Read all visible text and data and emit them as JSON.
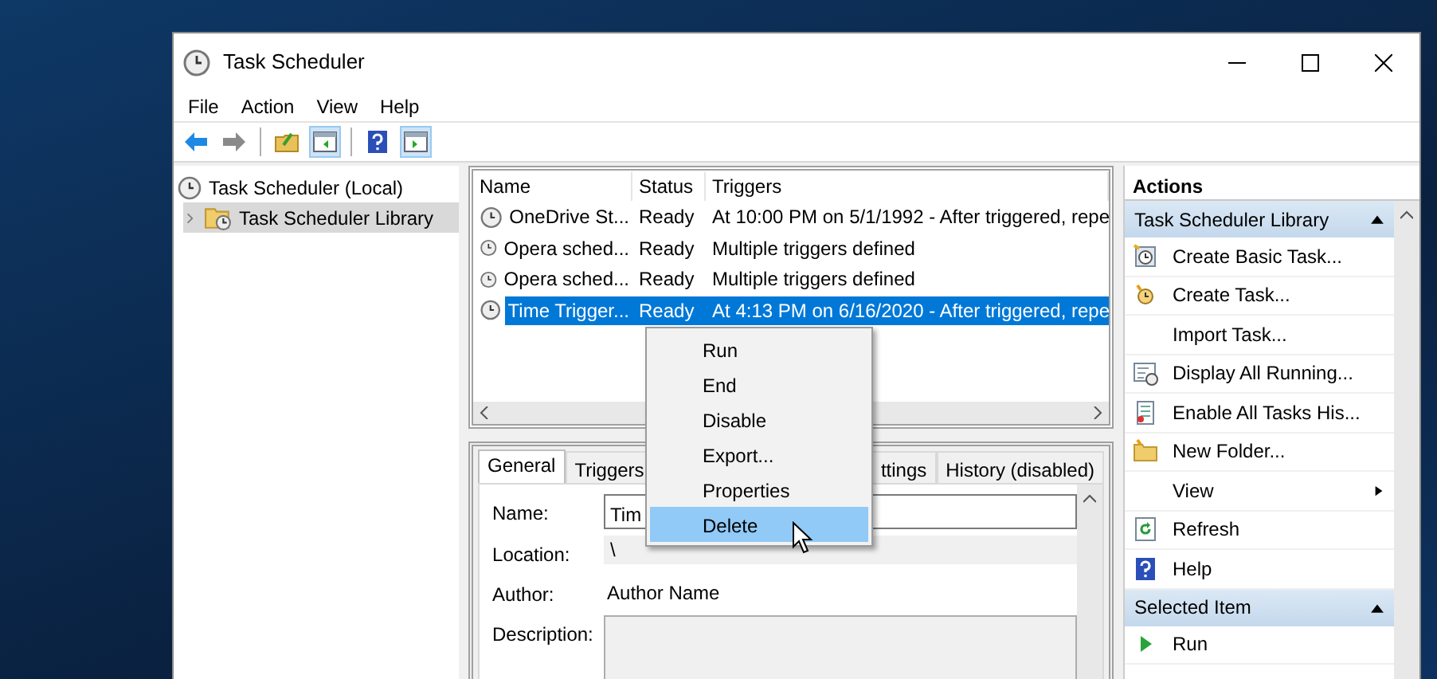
{
  "window": {
    "title": "Task Scheduler"
  },
  "menu": [
    "File",
    "Action",
    "View",
    "Help"
  ],
  "toolbar": [
    {
      "pressed": false
    },
    {
      "pressed": false
    },
    {
      "pressed": false
    },
    {
      "pressed": true
    },
    {
      "pressed": false
    },
    {
      "pressed": true
    }
  ],
  "tree": [
    {
      "label": "Task Scheduler (Local)",
      "selected": false,
      "children": [
        {
          "label": "Task Scheduler Library",
          "expanded": false,
          "selected": true
        }
      ]
    }
  ],
  "task_list": {
    "columns": [
      "Name",
      "Status",
      "Triggers"
    ],
    "rows": [
      {
        "name": "OneDrive St...",
        "status": "Ready",
        "triggers": "At 10:00 PM on 5/1/1992 - After triggered, repe",
        "selected": false
      },
      {
        "name": "Opera sched...",
        "status": "Ready",
        "triggers": "Multiple triggers defined",
        "selected": false
      },
      {
        "name": "Opera sched...",
        "status": "Ready",
        "triggers": "Multiple triggers defined",
        "selected": false
      },
      {
        "name": "Time Trigger...",
        "status": "Ready",
        "triggers": "At 4:13 PM on 6/16/2020 - After triggered, repe",
        "selected": true
      }
    ]
  },
  "detail_tabs": [
    {
      "label": "General",
      "selected": true
    },
    {
      "label": "Triggers",
      "selected": false
    },
    {
      "label": "ttings",
      "selected": false
    },
    {
      "label": "History (disabled)",
      "selected": false
    }
  ],
  "details": [
    {
      "kind": "input",
      "label": "Name:",
      "value": "Tim"
    },
    {
      "kind": "readonly",
      "label": "Location:",
      "value": "\\"
    },
    {
      "kind": "text",
      "label": "Author:",
      "value": "Author Name"
    },
    {
      "kind": "textarea",
      "label": "Description:"
    }
  ],
  "context_menu": [
    {
      "label": "Run",
      "selected": false
    },
    {
      "label": "End",
      "selected": false
    },
    {
      "label": "Disable",
      "selected": false
    },
    {
      "label": "Export...",
      "selected": false
    },
    {
      "label": "Properties",
      "selected": false
    },
    {
      "label": "Delete",
      "selected": true
    }
  ],
  "actions": {
    "title": "Actions",
    "groups": [
      {
        "title": "Task Scheduler Library",
        "expanded": true,
        "items": [
          {
            "label": "Create Basic Task..."
          },
          {
            "label": "Create Task..."
          },
          {
            "label": "Import Task..."
          },
          {
            "label": "Display All Running..."
          },
          {
            "label": "Enable All Tasks His..."
          },
          {
            "label": "New Folder..."
          },
          {
            "label": "View",
            "submenu": true
          },
          {
            "label": "Refresh"
          },
          {
            "label": "Help"
          }
        ]
      },
      {
        "title": "Selected Item",
        "expanded": true,
        "items": [
          {
            "label": "Run"
          }
        ]
      }
    ]
  }
}
